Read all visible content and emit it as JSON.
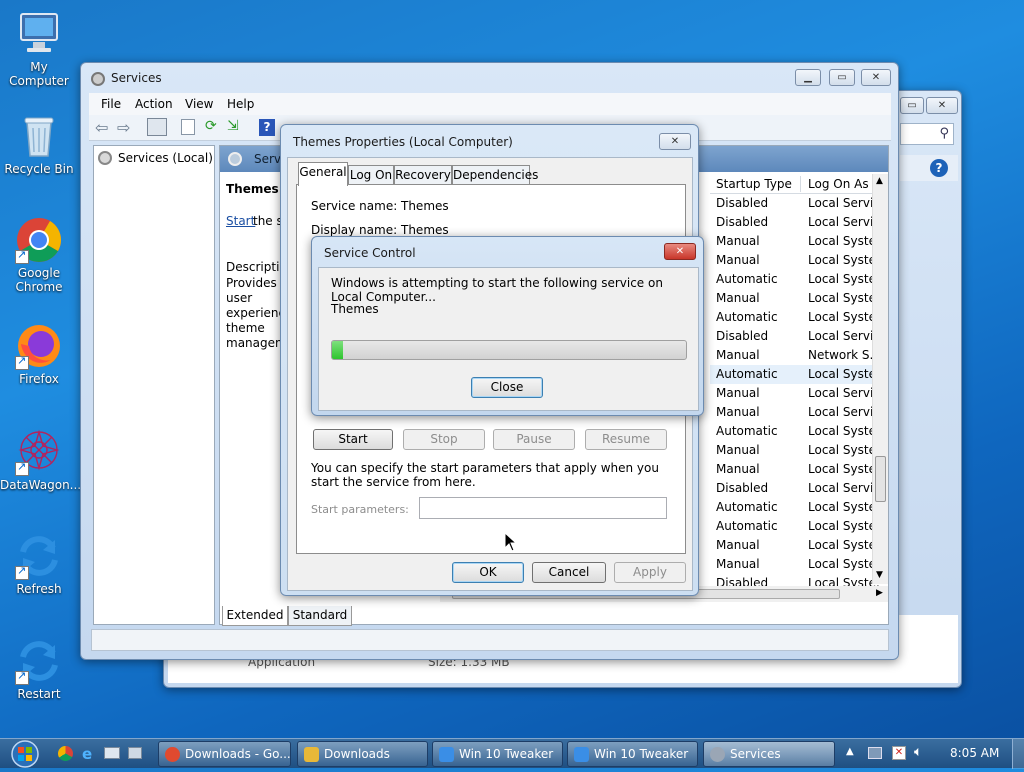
{
  "desktop": {
    "icons": [
      {
        "label": "My Computer"
      },
      {
        "label": "Recycle Bin"
      },
      {
        "label": "Google Chrome"
      },
      {
        "label": "Firefox"
      },
      {
        "label": "DataWagon..."
      },
      {
        "label": "Refresh"
      },
      {
        "label": "Restart"
      }
    ]
  },
  "back_window": {
    "footer_type": "Application",
    "footer_size": "Size: 1.33 MB"
  },
  "services_window": {
    "title": "Services",
    "menu": [
      "File",
      "Action",
      "View",
      "Help"
    ],
    "tree_root": "Services (Local)",
    "header_label": "Services (Local)",
    "selected_name": "Themes",
    "start_link": "Start",
    "start_suffix": " the service",
    "description_label": "Description:",
    "description_text": "Provides user experience theme management.",
    "columns": {
      "startup": "Startup Type",
      "logon": "Log On As"
    },
    "rows": [
      {
        "startup": "Disabled",
        "logon": "Local Servic"
      },
      {
        "startup": "Disabled",
        "logon": "Local Servic"
      },
      {
        "startup": "Manual",
        "logon": "Local Syste."
      },
      {
        "startup": "Manual",
        "logon": "Local Syste."
      },
      {
        "startup": "Automatic",
        "logon": "Local Syste."
      },
      {
        "startup": "Manual",
        "logon": "Local Syste."
      },
      {
        "startup": "Automatic",
        "logon": "Local Syste."
      },
      {
        "startup": "Disabled",
        "logon": "Local Servic"
      },
      {
        "startup": "Manual",
        "logon": "Network S..."
      },
      {
        "startup": "Automatic",
        "logon": "Local Syste."
      },
      {
        "startup": "Manual",
        "logon": "Local Servic"
      },
      {
        "startup": "Manual",
        "logon": "Local Servic"
      },
      {
        "startup": "Automatic",
        "logon": "Local Syste."
      },
      {
        "startup": "Manual",
        "logon": "Local Syste."
      },
      {
        "startup": "Manual",
        "logon": "Local Syste."
      },
      {
        "startup": "Disabled",
        "logon": "Local Servic"
      },
      {
        "startup": "Automatic",
        "logon": "Local Syste."
      },
      {
        "startup": "Automatic",
        "logon": "Local Syste."
      },
      {
        "startup": "Manual",
        "logon": "Local Syste."
      },
      {
        "startup": "Manual",
        "logon": "Local Syste."
      },
      {
        "startup": "Disabled",
        "logon": "Local Syste."
      }
    ],
    "bottom_tabs": [
      "Extended",
      "Standard"
    ]
  },
  "properties_dialog": {
    "title": "Themes Properties (Local Computer)",
    "tabs": [
      "General",
      "Log On",
      "Recovery",
      "Dependencies"
    ],
    "service_name_label": "Service name:",
    "service_name_value": "Themes",
    "display_name_label": "Display name:",
    "display_name_value": "Themes",
    "buttons": {
      "start": "Start",
      "stop": "Stop",
      "pause": "Pause",
      "resume": "Resume"
    },
    "params_hint": "You can specify the start parameters that apply when you start the service from here.",
    "params_label": "Start parameters:",
    "params_value": "",
    "ok": "OK",
    "cancel": "Cancel",
    "apply": "Apply"
  },
  "service_control": {
    "title": "Service Control",
    "message": "Windows is attempting to start the following service on Local Computer...",
    "service": "Themes",
    "progress_percent": 3,
    "close": "Close"
  },
  "taskbar": {
    "items": [
      {
        "label": "Downloads - Go...",
        "color": "#e04a2f"
      },
      {
        "label": "Downloads",
        "color": "#e8b838"
      },
      {
        "label": "Win 10 Tweaker",
        "color": "#3a8ee6"
      },
      {
        "label": "Win 10 Tweaker",
        "color": "#3a8ee6"
      },
      {
        "label": "Services",
        "color": "#9aa6b5"
      }
    ],
    "clock": "8:05 AM"
  },
  "colors": {
    "accent": "#1f8de0",
    "progress": "#2ec52e",
    "close_red": "#c8362a"
  }
}
